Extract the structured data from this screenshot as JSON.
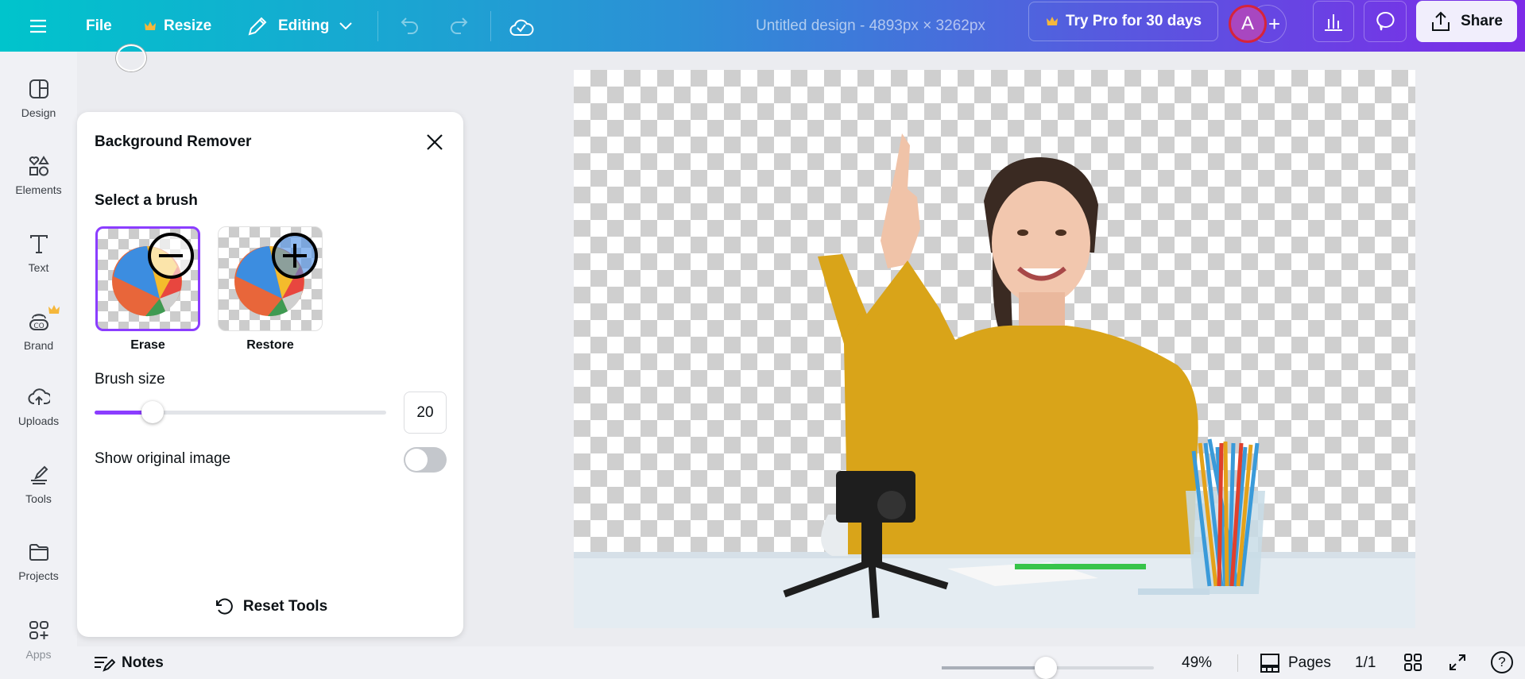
{
  "topbar": {
    "file": "File",
    "resize": "Resize",
    "editing": "Editing",
    "title": "Untitled design - 4893px × 3262px",
    "try_pro": "Try Pro for 30 days",
    "avatar_initial": "A",
    "share": "Share"
  },
  "sidebar": {
    "items": [
      {
        "label": "Design"
      },
      {
        "label": "Elements"
      },
      {
        "label": "Text"
      },
      {
        "label": "Brand"
      },
      {
        "label": "Uploads"
      },
      {
        "label": "Tools"
      },
      {
        "label": "Projects"
      },
      {
        "label": "Apps"
      }
    ]
  },
  "panel": {
    "title": "Background Remover",
    "select_brush": "Select a brush",
    "brushes": [
      {
        "label": "Erase",
        "selected": true
      },
      {
        "label": "Restore",
        "selected": false
      }
    ],
    "brush_size_label": "Brush size",
    "brush_size_value": "20",
    "brush_size_fraction": 0.2,
    "show_original_label": "Show original image",
    "show_original_on": false,
    "reset": "Reset Tools"
  },
  "bottombar": {
    "notes": "Notes",
    "zoom": "49%",
    "zoom_fraction": 0.49,
    "pages": "Pages",
    "page_count": "1/1"
  },
  "colors": {
    "accent": "#8b3dff",
    "pro_crown": "#f5b73b"
  }
}
